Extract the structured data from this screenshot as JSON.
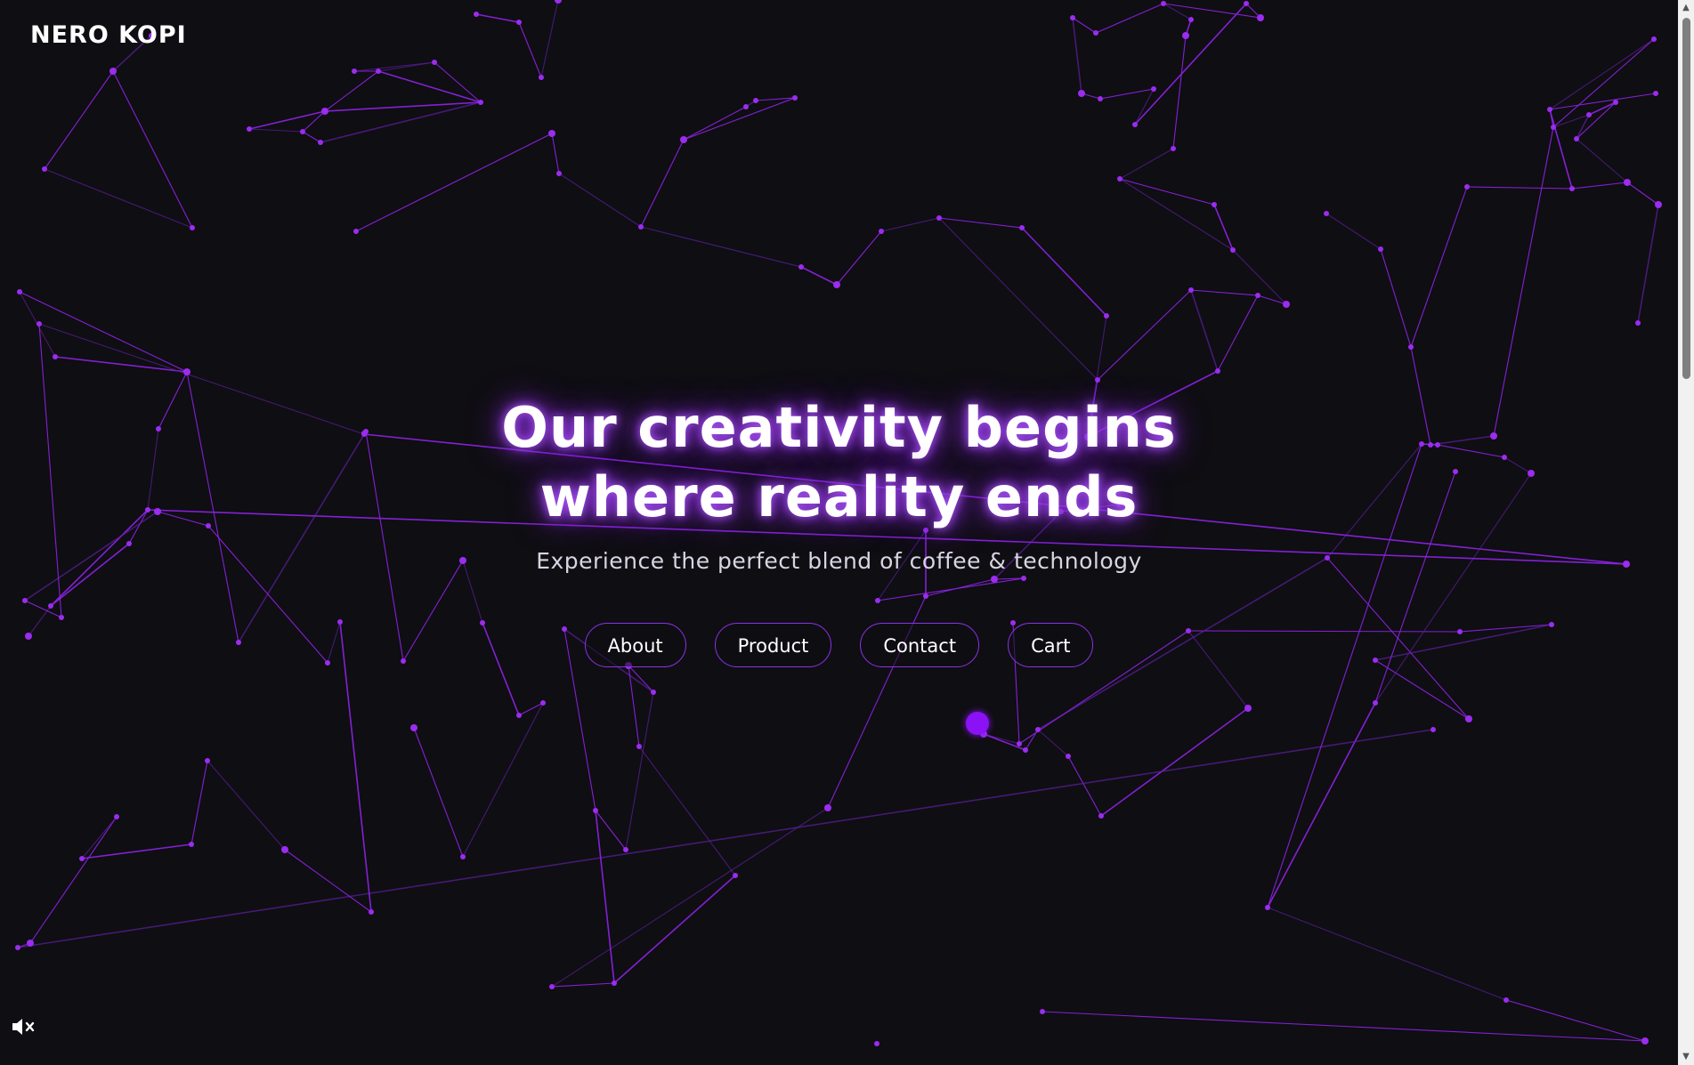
{
  "brand": {
    "name": "NERO KOPI"
  },
  "hero": {
    "headline_line1": "Our creativity begins",
    "headline_line2": "where reality ends",
    "subtitle": "Experience the perfect blend of coffee & technology"
  },
  "nav": {
    "about": "About",
    "product": "Product",
    "contact": "Contact",
    "cart": "Cart"
  },
  "theme": {
    "background": "#0f0e12",
    "accent": "#8b31e8",
    "glow": "#a855f7",
    "text": "#ffffff"
  },
  "icons": {
    "mute": "speaker-muted-icon",
    "scroll_up": "triangle-up-icon",
    "scroll_down": "triangle-down-icon"
  },
  "scroll_position": 0
}
